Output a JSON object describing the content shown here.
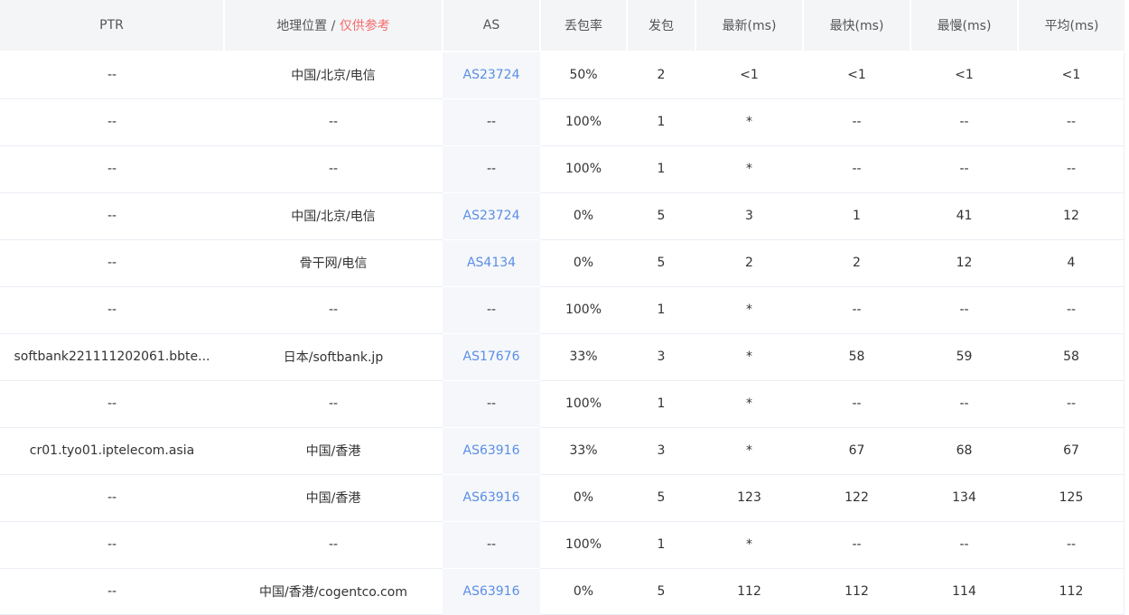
{
  "colors": {
    "link": "#5b8ee6",
    "reference_note": "#f56c6c",
    "header_bg": "#f4f5f7"
  },
  "headers": {
    "ptr": "PTR",
    "geo": "地理位置",
    "geo_sep": " / ",
    "geo_note": "仅供参考",
    "as": "AS",
    "loss": "丢包率",
    "sent": "发包",
    "last": "最新(ms)",
    "best": "最快(ms)",
    "worst": "最慢(ms)",
    "avg": "平均(ms)"
  },
  "rows": [
    {
      "ptr": "--",
      "geo": "中国/北京/电信",
      "as": "AS23724",
      "loss": "50%",
      "sent": "2",
      "last": "<1",
      "best": "<1",
      "worst": "<1",
      "avg": "<1"
    },
    {
      "ptr": "--",
      "geo": "--",
      "as": "--",
      "loss": "100%",
      "sent": "1",
      "last": "*",
      "best": "--",
      "worst": "--",
      "avg": "--"
    },
    {
      "ptr": "--",
      "geo": "--",
      "as": "--",
      "loss": "100%",
      "sent": "1",
      "last": "*",
      "best": "--",
      "worst": "--",
      "avg": "--"
    },
    {
      "ptr": "--",
      "geo": "中国/北京/电信",
      "as": "AS23724",
      "loss": "0%",
      "sent": "5",
      "last": "3",
      "best": "1",
      "worst": "41",
      "avg": "12"
    },
    {
      "ptr": "--",
      "geo": "骨干网/电信",
      "as": "AS4134",
      "loss": "0%",
      "sent": "5",
      "last": "2",
      "best": "2",
      "worst": "12",
      "avg": "4"
    },
    {
      "ptr": "--",
      "geo": "--",
      "as": "--",
      "loss": "100%",
      "sent": "1",
      "last": "*",
      "best": "--",
      "worst": "--",
      "avg": "--"
    },
    {
      "ptr": "softbank221111202061.bbte...",
      "geo": "日本/softbank.jp",
      "as": "AS17676",
      "loss": "33%",
      "sent": "3",
      "last": "*",
      "best": "58",
      "worst": "59",
      "avg": "58"
    },
    {
      "ptr": "--",
      "geo": "--",
      "as": "--",
      "loss": "100%",
      "sent": "1",
      "last": "*",
      "best": "--",
      "worst": "--",
      "avg": "--"
    },
    {
      "ptr": "cr01.tyo01.iptelecom.asia",
      "geo": "中国/香港",
      "as": "AS63916",
      "loss": "33%",
      "sent": "3",
      "last": "*",
      "best": "67",
      "worst": "68",
      "avg": "67"
    },
    {
      "ptr": "--",
      "geo": "中国/香港",
      "as": "AS63916",
      "loss": "0%",
      "sent": "5",
      "last": "123",
      "best": "122",
      "worst": "134",
      "avg": "125"
    },
    {
      "ptr": "--",
      "geo": "--",
      "as": "--",
      "loss": "100%",
      "sent": "1",
      "last": "*",
      "best": "--",
      "worst": "--",
      "avg": "--"
    },
    {
      "ptr": "--",
      "geo": "中国/香港/cogentco.com",
      "as": "AS63916",
      "loss": "0%",
      "sent": "5",
      "last": "112",
      "best": "112",
      "worst": "114",
      "avg": "112"
    }
  ]
}
